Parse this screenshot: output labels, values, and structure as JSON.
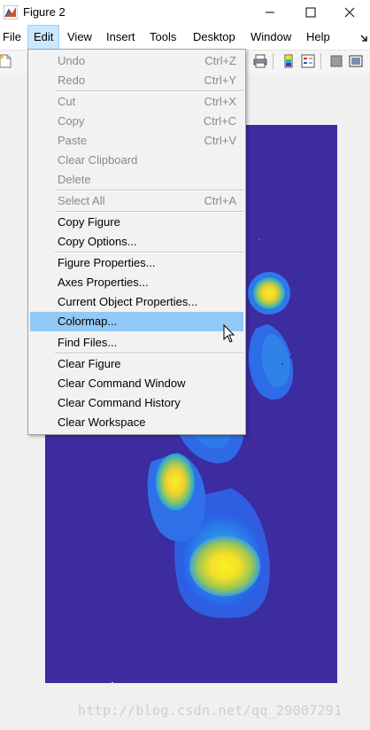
{
  "window": {
    "title": "Figure 2",
    "minimize_icon": "minimize-icon",
    "maximize_icon": "maximize-icon",
    "close_icon": "close-icon"
  },
  "menubar": {
    "items": [
      {
        "label": "File"
      },
      {
        "label": "Edit",
        "active": true
      },
      {
        "label": "View"
      },
      {
        "label": "Insert"
      },
      {
        "label": "Tools"
      },
      {
        "label": "Desktop"
      },
      {
        "label": "Window"
      },
      {
        "label": "Help"
      }
    ],
    "overflow_icon": "chevron-right-icon"
  },
  "toolbar": {
    "icons": [
      "new-figure-icon",
      "print-icon",
      "colorbar-icon",
      "legend-icon",
      "hide-plot-tools-icon",
      "show-plot-tools-icon"
    ]
  },
  "edit_menu": {
    "items": [
      {
        "label": "Undo",
        "shortcut": "Ctrl+Z",
        "enabled": false
      },
      {
        "label": "Redo",
        "shortcut": "Ctrl+Y",
        "enabled": false
      },
      {
        "label": "Cut",
        "shortcut": "Ctrl+X",
        "enabled": false
      },
      {
        "label": "Copy",
        "shortcut": "Ctrl+C",
        "enabled": false
      },
      {
        "label": "Paste",
        "shortcut": "Ctrl+V",
        "enabled": false
      },
      {
        "label": "Clear Clipboard",
        "shortcut": "",
        "enabled": false
      },
      {
        "label": "Delete",
        "shortcut": "",
        "enabled": false
      },
      {
        "label": "Select All",
        "shortcut": "Ctrl+A",
        "enabled": false
      },
      {
        "label": "Copy Figure",
        "shortcut": "",
        "enabled": true
      },
      {
        "label": "Copy Options...",
        "shortcut": "",
        "enabled": true
      },
      {
        "label": "Figure Properties...",
        "shortcut": "",
        "enabled": true
      },
      {
        "label": "Axes Properties...",
        "shortcut": "",
        "enabled": true
      },
      {
        "label": "Current Object Properties...",
        "shortcut": "",
        "enabled": true
      },
      {
        "label": "Colormap...",
        "shortcut": "",
        "enabled": true,
        "highlighted": true
      },
      {
        "label": "Find Files...",
        "shortcut": "",
        "enabled": true
      },
      {
        "label": "Clear Figure",
        "shortcut": "",
        "enabled": true
      },
      {
        "label": "Clear Command Window",
        "shortcut": "",
        "enabled": true
      },
      {
        "label": "Clear Command History",
        "shortcut": "",
        "enabled": true
      },
      {
        "label": "Clear Workspace",
        "shortcut": "",
        "enabled": true
      }
    ]
  },
  "colors": {
    "plot_background": "#3c2ca0",
    "menu_highlight": "#91c9f7",
    "active_menu": "#cce8ff"
  },
  "watermark": "http://blog.csdn.net/qq_29007291"
}
